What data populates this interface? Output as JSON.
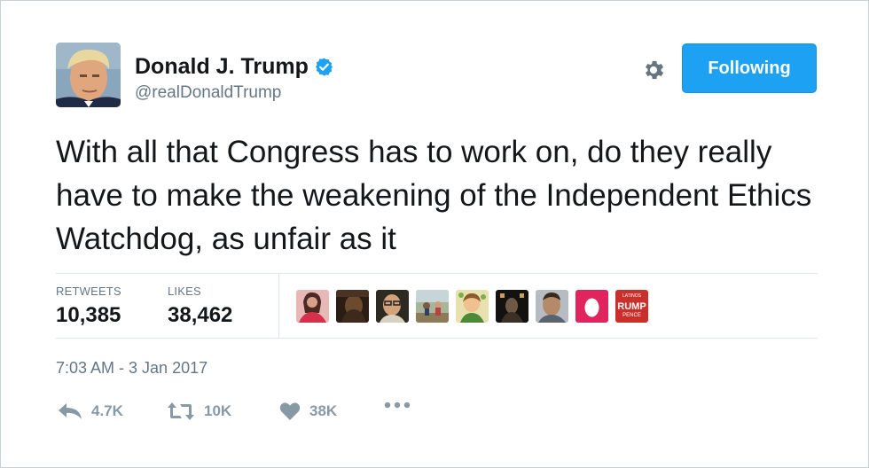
{
  "header": {
    "display_name": "Donald J. Trump",
    "handle": "@realDonaldTrump",
    "follow_label": "Following"
  },
  "tweet": {
    "text": "With all that Congress has to work on, do they really have to make the weakening of the Independent Ethics Watchdog, as unfair as it"
  },
  "stats": {
    "retweets_label": "RETWEETS",
    "retweets_value": "10,385",
    "likes_label": "LIKES",
    "likes_value": "38,462"
  },
  "likers": [
    {
      "icon": "avatar-woman-red"
    },
    {
      "icon": "avatar-dark-photo"
    },
    {
      "icon": "avatar-man-glasses"
    },
    {
      "icon": "avatar-outdoor-group"
    },
    {
      "icon": "avatar-cartoon-green"
    },
    {
      "icon": "avatar-dark-figure"
    },
    {
      "icon": "avatar-man-portrait"
    },
    {
      "icon": "avatar-egg-default"
    },
    {
      "icon": "avatar-trump-pence-sign",
      "text_top": "LATINOS",
      "text_mid": "RUMP",
      "text_bot": "PENCE"
    }
  ],
  "timestamp": "7:03 AM - 3 Jan 2017",
  "actions": {
    "reply_count": "4.7K",
    "retweet_count": "10K",
    "like_count": "38K"
  },
  "colors": {
    "accent": "#1da1f2",
    "verified": "#1da1f2",
    "muted": "#657786",
    "action": "#8899a6"
  }
}
